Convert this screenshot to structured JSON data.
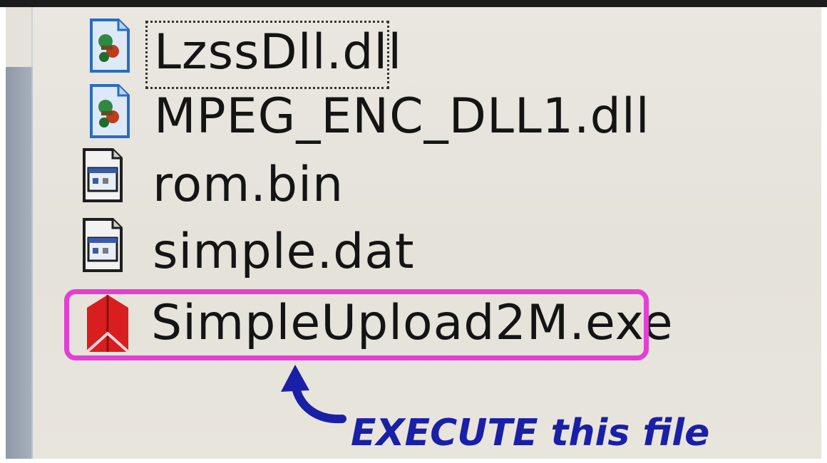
{
  "explorer": {
    "files": [
      {
        "name": "LzssDll.dll",
        "icon": "dll-file-icon"
      },
      {
        "name": "MPEG_ENC_DLL1.dll",
        "icon": "dll-file-icon"
      },
      {
        "name": "rom.bin",
        "icon": "generic-file-icon"
      },
      {
        "name": "simple.dat",
        "icon": "generic-file-icon"
      },
      {
        "name": "SimpleUpload2M.exe",
        "icon": "executable-file-icon"
      }
    ]
  },
  "annotation": {
    "text": "EXECUTE this file",
    "color": "#1a1fa8",
    "highlight_color": "#e43fd4"
  }
}
